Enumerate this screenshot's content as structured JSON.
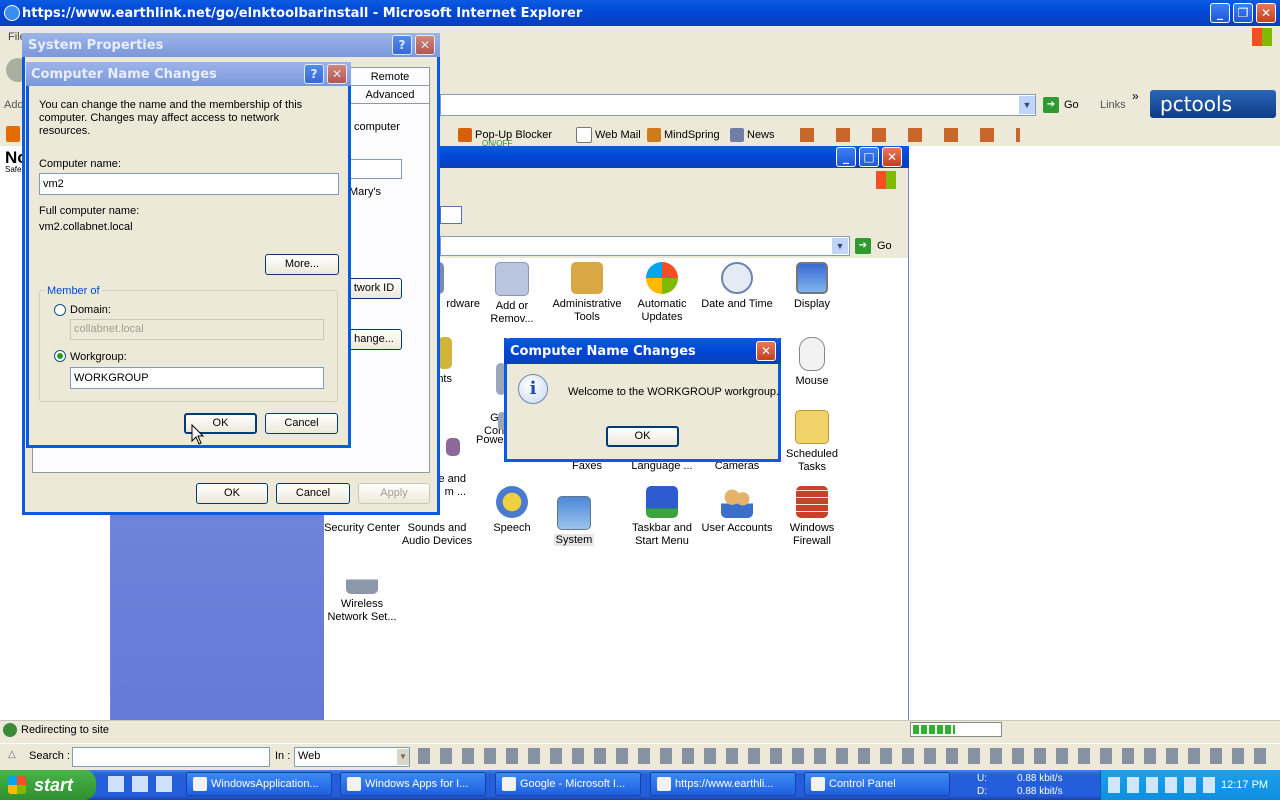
{
  "ie": {
    "title": "https://www.earthlink.net/go/elnktoolbarinstall - Microsoft Internet Explorer",
    "menu_file": "File",
    "address_label": "Add",
    "go_label": "Go",
    "links_label": "Links",
    "chevron": "»",
    "pctools": "pctools",
    "status_text": "Redirecting to site",
    "toolbar": {
      "popup_blocker": "Pop-Up Blocker",
      "popup_state": "ON/OFF",
      "web_mail": "Web Mail",
      "mindspring": "MindSpring",
      "news": "News",
      "no_label": "No",
      "safe_label": "Safe"
    },
    "search_label": "Search :",
    "in_label": "In :",
    "in_value": "Web"
  },
  "control_panel": {
    "go_label": "Go",
    "items": [
      {
        "label": "Hardware",
        "visible_label": "rdware"
      },
      {
        "label": "Add or Remov..."
      },
      {
        "label": "Administrative Tools"
      },
      {
        "label": "Automatic Updates"
      },
      {
        "label": "Date and Time"
      },
      {
        "label": "Display"
      },
      {
        "label": "Mouse"
      },
      {
        "label": "Fonts",
        "visible_label": "nts"
      },
      {
        "label": "Game Controllers",
        "visible_label": "G\nCon"
      },
      {
        "label": "Power Options",
        "visible_label": "Powe"
      },
      {
        "label": "Phone and Modem ...",
        "visible_label": "e and\nm ..."
      },
      {
        "label": "Faxes"
      },
      {
        "label": "Language ..."
      },
      {
        "label": "Cameras"
      },
      {
        "label": "Scheduled Tasks"
      },
      {
        "label": "Security Center"
      },
      {
        "label": "Sounds and Audio Devices"
      },
      {
        "label": "Speech"
      },
      {
        "label": "System"
      },
      {
        "label": "Taskbar and Start Menu"
      },
      {
        "label": "User Accounts"
      },
      {
        "label": "Windows Firewall"
      },
      {
        "label": "Wireless Network Set..."
      }
    ]
  },
  "system_properties": {
    "title": "System Properties",
    "tab_remote": "Remote",
    "tab_advanced": "Advanced",
    "text_computer": "computer",
    "text_marys": "Mary's",
    "btn_network_id": "twork ID",
    "btn_change": "hange...",
    "ok": "OK",
    "cancel": "Cancel",
    "apply": "Apply"
  },
  "name_changes": {
    "title": "Computer Name Changes",
    "description": "You can change the name and the membership of this computer. Changes may affect access to network resources.",
    "computer_name_label": "Computer name:",
    "computer_name_value": "vm2",
    "full_name_label": "Full computer name:",
    "full_name_value": "vm2.collabnet.local",
    "more": "More...",
    "member_of": "Member of",
    "domain_label": "Domain:",
    "domain_value": "collabnet.local",
    "workgroup_label": "Workgroup:",
    "workgroup_value": "WORKGROUP",
    "ok": "OK",
    "cancel": "Cancel"
  },
  "message_box": {
    "title": "Computer Name Changes",
    "message": "Welcome to the WORKGROUP workgroup.",
    "ok": "OK"
  },
  "taskbar": {
    "start": "start",
    "buttons": [
      "WindowsApplication...",
      "Windows Apps for I...",
      "Google - Microsoft I...",
      "https://www.earthli...",
      "Control Panel"
    ],
    "net_u_label": "U:",
    "net_d_label": "D:",
    "net_u": "0.88 kbit/s",
    "net_d": "0.88 kbit/s",
    "clock": "12:17 PM"
  },
  "colors": {
    "xp_blue": "#0a5be0",
    "desktop_taskbar": "#245edb",
    "start_green": "#3c9a3c",
    "cp_sidebar": "#6f86dd",
    "dialog_face": "#ece9d8"
  }
}
